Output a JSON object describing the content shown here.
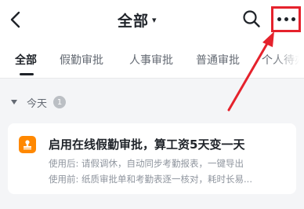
{
  "header": {
    "title": "全部",
    "caret": "▾"
  },
  "tabs": [
    {
      "label": "全部",
      "active": true
    },
    {
      "label": "假勤审批",
      "active": false
    },
    {
      "label": "人事审批",
      "active": false
    },
    {
      "label": "普通审批",
      "active": false
    },
    {
      "label": "个人待办",
      "active": false
    }
  ],
  "section": {
    "title": "今天",
    "count": "1"
  },
  "card": {
    "title": "启用在线假勤审批，算工资5天变一天",
    "after_line": "使用后: 请假调休，自动同步考勤报表，一键导出",
    "before_line": "使用前: 纸质审批单和考勤表逐一核对，耗时长易..."
  },
  "colors": {
    "accent": "#1f2329",
    "highlight_box": "#e5222c",
    "card_icon": "#ff8800",
    "background": "#f4f5f7"
  },
  "icons": {
    "back": "chevron-left-icon",
    "search": "search-icon",
    "more": "more-horizontal-icon",
    "card": "stamp-icon"
  }
}
